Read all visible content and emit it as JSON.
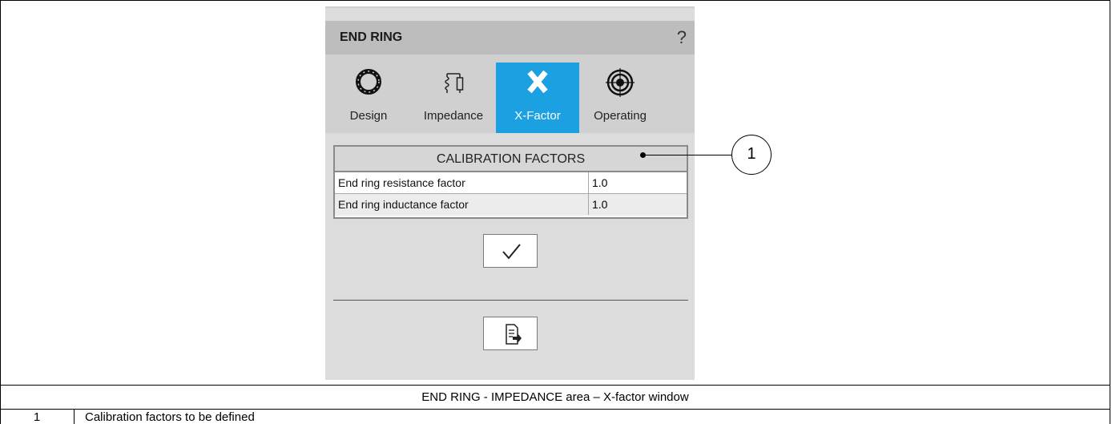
{
  "window": {
    "title": "END RING",
    "help_label": "?"
  },
  "tabs": [
    {
      "label": "Design",
      "icon": "ring-icon",
      "active": false
    },
    {
      "label": "Impedance",
      "icon": "impedance-icon",
      "active": false
    },
    {
      "label": "X-Factor",
      "icon": "x-icon",
      "active": true
    },
    {
      "label": "Operating",
      "icon": "target-icon",
      "active": false
    }
  ],
  "calibration": {
    "title": "CALIBRATION FACTORS",
    "rows": [
      {
        "label": "End ring resistance factor",
        "value": "1.0"
      },
      {
        "label": "End ring inductance factor",
        "value": "1.0"
      }
    ]
  },
  "buttons": {
    "ok_icon": "checkmark-icon",
    "export_icon": "export-icon"
  },
  "callout": {
    "number": "1"
  },
  "caption": "END RING - IMPEDANCE area – X-factor window",
  "legend": {
    "number": "1",
    "text": "Calibration factors to be defined"
  },
  "colors": {
    "accent": "#1ba1e2",
    "panel": "#dcdcdc",
    "titlebar": "#bdbdbd"
  }
}
